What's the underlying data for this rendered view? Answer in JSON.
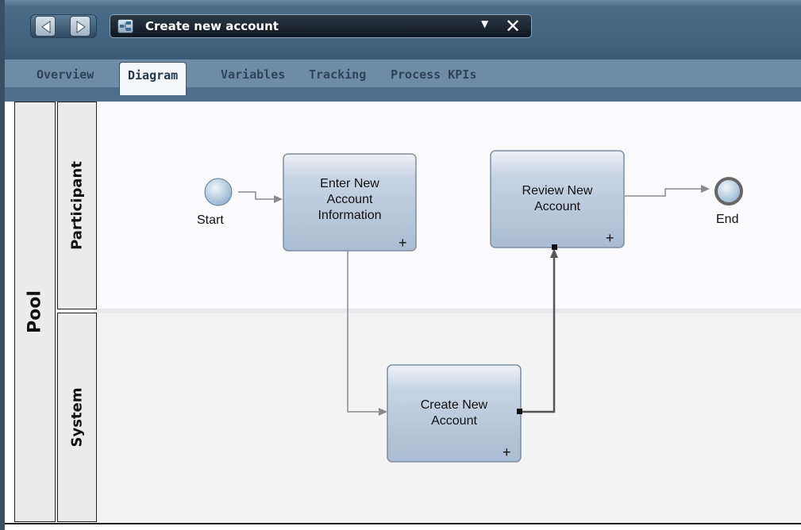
{
  "editor": {
    "title": "Create new account",
    "dropdown": "▼",
    "close": "✕"
  },
  "tabs": [
    {
      "label": "Overview"
    },
    {
      "label": "Diagram"
    },
    {
      "label": "Variables"
    },
    {
      "label": "Tracking"
    },
    {
      "label": "Process KPIs"
    }
  ],
  "pool": {
    "label": "Pool"
  },
  "lanes": [
    {
      "label": "Participant"
    },
    {
      "label": "System"
    }
  ],
  "events": {
    "start": "Start",
    "end": "End"
  },
  "tasks": [
    {
      "label1": "Enter New",
      "label2": "Account",
      "label3": "Information",
      "marker": "+"
    },
    {
      "label1": "Review New",
      "label2": "Account",
      "marker": "+"
    },
    {
      "label1": "Create New",
      "label2": "Account",
      "marker": "+"
    }
  ],
  "colors": {
    "toolbar": "#3f617e",
    "task_fill": "#b9c9dc",
    "connector": "#8a8a8a"
  }
}
